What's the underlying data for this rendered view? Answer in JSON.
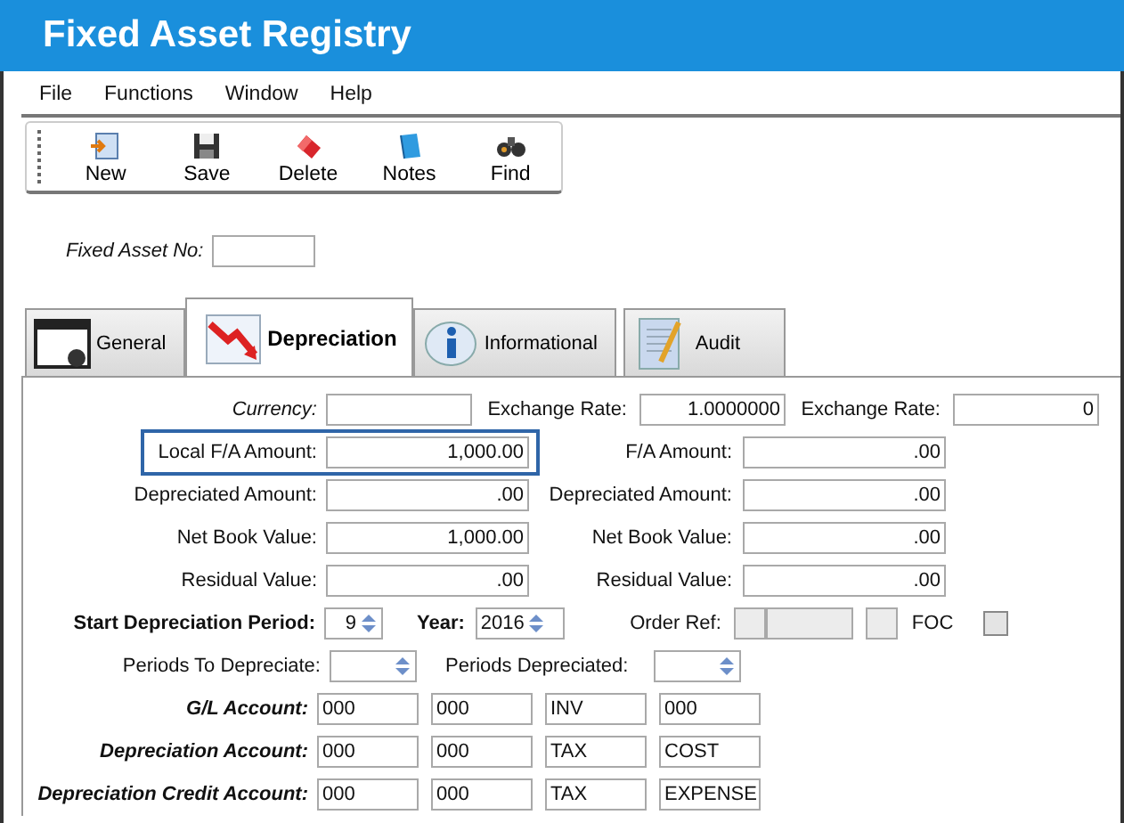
{
  "window": {
    "title": "Fixed Asset Registry"
  },
  "menu": [
    "File",
    "Functions",
    "Window",
    "Help"
  ],
  "toolbar": [
    {
      "label": "New",
      "kind": "new"
    },
    {
      "label": "Save",
      "kind": "save"
    },
    {
      "label": "Delete",
      "kind": "delete"
    },
    {
      "label": "Notes",
      "kind": "notes"
    },
    {
      "label": "Find",
      "kind": "find"
    }
  ],
  "asset_no": {
    "label": "Fixed Asset No:"
  },
  "tabs": [
    {
      "label": "General",
      "kind": "general",
      "selected": false
    },
    {
      "label": "Depreciation",
      "kind": "depreciation",
      "selected": true
    },
    {
      "label": "Informational",
      "kind": "info",
      "selected": false
    },
    {
      "label": "Audit",
      "kind": "audit",
      "selected": false
    }
  ],
  "currency": {
    "label": "Currency:"
  },
  "exchange_rates": [
    {
      "label": "Exchange Rate:",
      "value": "1.0000000"
    },
    {
      "label": "Exchange Rate:",
      "value": "0"
    }
  ],
  "amounts": [
    {
      "label": "Local F/A Amount:",
      "value": "1,000.00",
      "highlighted": true,
      "label_2": "F/A Amount:",
      "value_2": ".00"
    },
    {
      "label": "Depreciated Amount:",
      "value": ".00",
      "highlighted": false,
      "label_2": "Depreciated Amount:",
      "value_2": ".00"
    },
    {
      "label": "Net Book Value:",
      "value": "1,000.00",
      "highlighted": false,
      "label_2": "Net Book Value:",
      "value_2": ".00"
    },
    {
      "label": "Residual Value:",
      "value": ".00",
      "highlighted": false,
      "label_2": "Residual Value:",
      "value_2": ".00"
    }
  ],
  "start_period": {
    "label": "Start Depreciation Period:",
    "value": "9"
  },
  "year": {
    "label": "Year:",
    "value": "2016"
  },
  "order_ref": {
    "label": "Order Ref:"
  },
  "foc": {
    "label": "FOC",
    "checked": false
  },
  "periods_to_depreciate": {
    "label": "Periods To Depreciate:"
  },
  "periods_depreciated": {
    "label": "Periods Depreciated:"
  },
  "accounts": [
    {
      "label": "G/L Account:",
      "segments": [
        "000",
        "000",
        "INV",
        "000"
      ]
    },
    {
      "label": "Depreciation Account:",
      "segments": [
        "000",
        "000",
        "TAX",
        "COST"
      ]
    },
    {
      "label": "Depreciation Credit Account:",
      "segments": [
        "000",
        "000",
        "TAX",
        "EXPENSE"
      ]
    }
  ]
}
